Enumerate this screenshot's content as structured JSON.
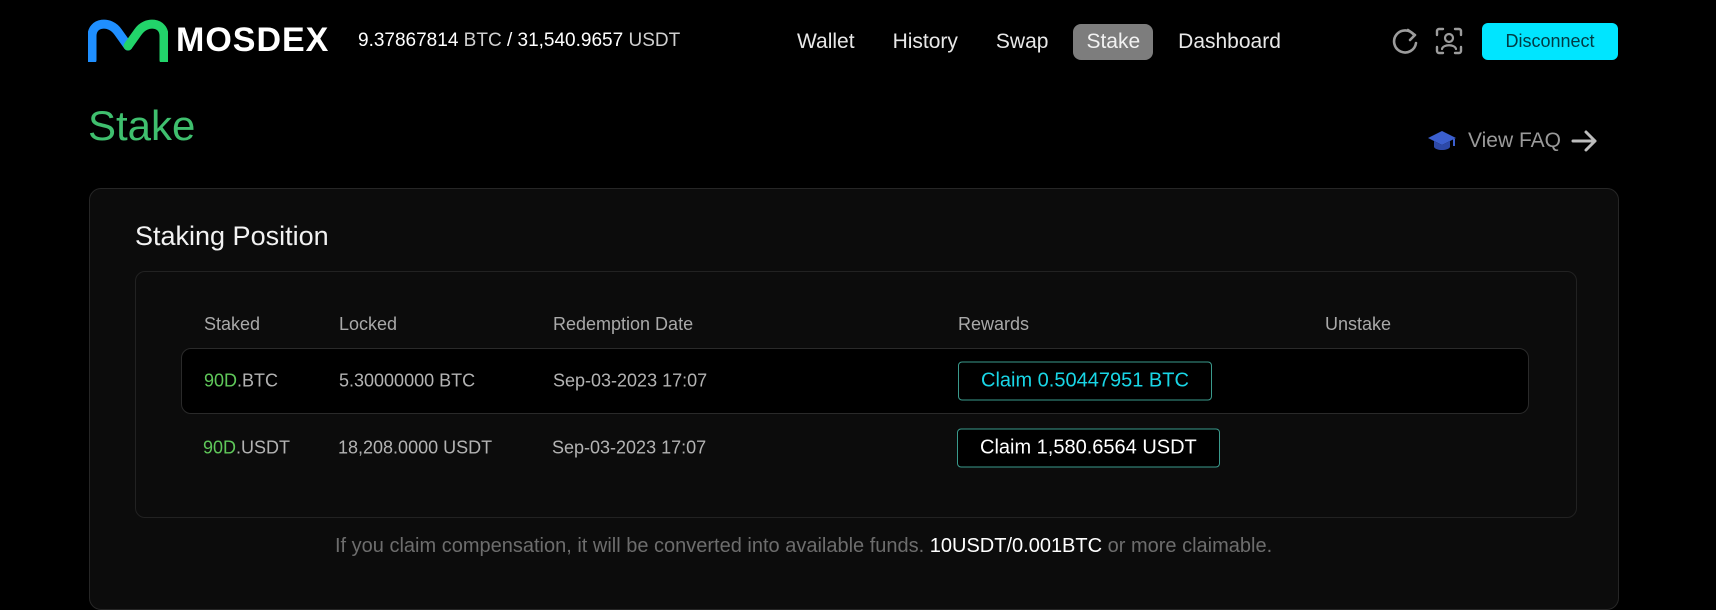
{
  "brand": {
    "name": "MOSDEX",
    "colors": {
      "mark_left": "#1f8fff",
      "mark_right": "#22d46a",
      "accent": "#00e5ff",
      "title_green": "#3fbf6e"
    }
  },
  "header": {
    "balance": {
      "btc_amount": "9.37867814",
      "btc_unit": "BTC",
      "separator": "/",
      "usdt_amount": "31,540.9657",
      "usdt_unit": "USDT"
    },
    "nav": [
      "Wallet",
      "History",
      "Swap",
      "Stake",
      "Dashboard"
    ],
    "active_nav": "Stake",
    "icons": {
      "refresh": "refresh-icon",
      "account": "face-id-icon"
    },
    "disconnect_label": "Disconnect"
  },
  "page": {
    "title": "Stake",
    "faq_label": "View FAQ"
  },
  "staking": {
    "title": "Staking Position",
    "columns": [
      "Staked",
      "Locked",
      "Redemption Date",
      "Rewards",
      "Unstake"
    ],
    "rows": [
      {
        "term": "90D",
        "asset": ".BTC",
        "locked": "5.30000000 BTC",
        "redemption_date": "Sep-03-2023 17:07",
        "reward_label": "Claim 0.50447951 BTC"
      },
      {
        "term": "90D",
        "asset": ".USDT",
        "locked": "18,208.0000 USDT",
        "redemption_date": "Sep-03-2023 17:07",
        "reward_label": "Claim 1,580.6564 USDT"
      }
    ],
    "note": {
      "before": "If you claim compensation, it will be converted into available funds. ",
      "highlight": "10USDT/0.001BTC",
      "after": " or more claimable."
    }
  }
}
